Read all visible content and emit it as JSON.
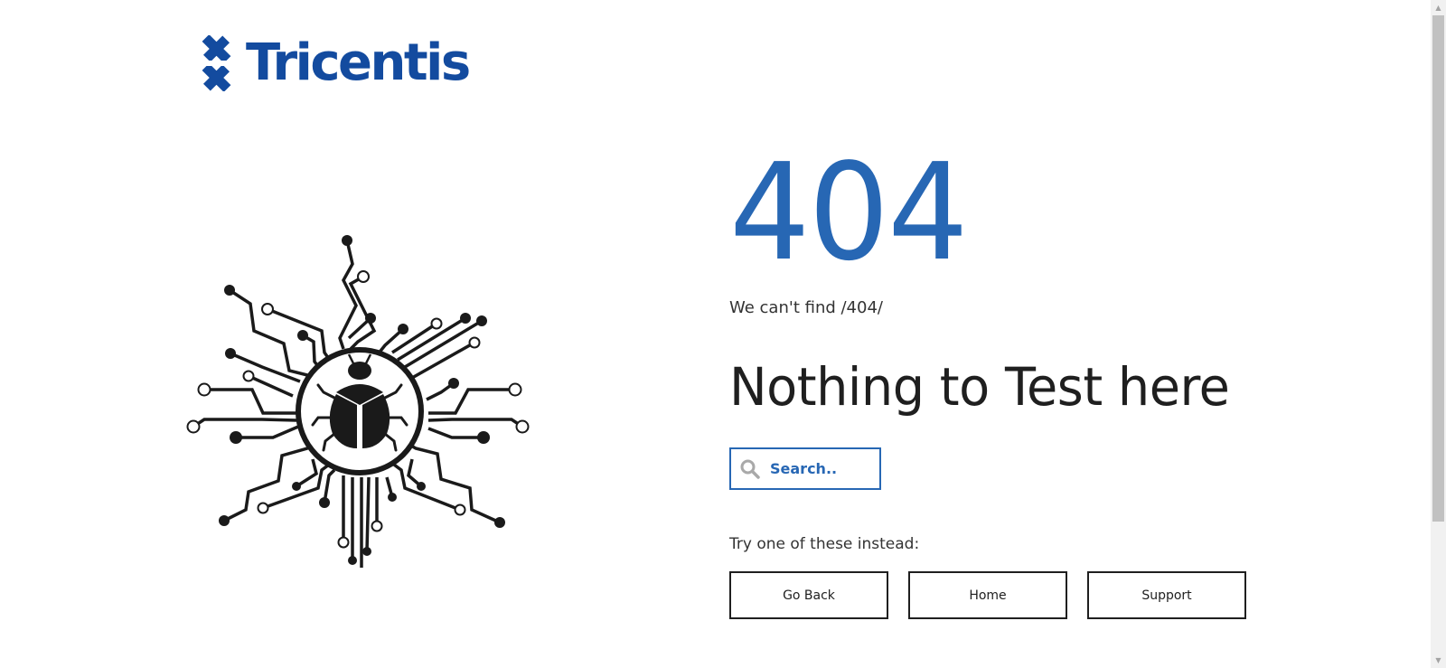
{
  "brand": {
    "name": "Tricentis",
    "color": "#134b9f"
  },
  "error": {
    "code": "404",
    "message": "We can't find /404/",
    "headline": "Nothing to Test here"
  },
  "search": {
    "placeholder": "Search..",
    "icon": "magnifier-icon"
  },
  "suggestions": {
    "label": "Try one of these instead:",
    "buttons": [
      {
        "label": "Go Back"
      },
      {
        "label": "Home"
      },
      {
        "label": "Support"
      }
    ]
  },
  "colors": {
    "accent": "#2767b4",
    "text": "#1f1f1f"
  }
}
